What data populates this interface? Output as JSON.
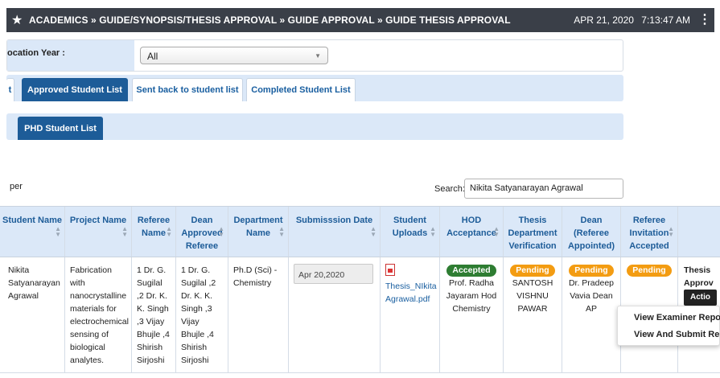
{
  "header": {
    "breadcrumb": "ACADEMICS » GUIDE/SYNOPSIS/THESIS APPROVAL » GUIDE APPROVAL » GUIDE THESIS APPROVAL",
    "date": "APR 21, 2020",
    "time": "7:13:47 AM",
    "icons": [
      "star-icon",
      "kebab-menu-icon"
    ]
  },
  "filter": {
    "label": "ocation Year :",
    "value": "All"
  },
  "tabs": [
    {
      "label": "t",
      "active": false
    },
    {
      "label": "Approved Student List",
      "active": true
    },
    {
      "label": "Sent back to student list",
      "active": false
    },
    {
      "label": "Completed Student List",
      "active": false
    }
  ],
  "subtabs": [
    {
      "label": "PHD Student List",
      "active": true
    }
  ],
  "list": {
    "per_text": "per",
    "search_label": "Search:",
    "search_value": "Nikita Satyanarayan Agrawal"
  },
  "table": {
    "headers": [
      "Student Name",
      "Project Name",
      "Referee Name",
      "Dean Approved Referee",
      "Department Name",
      "Submisssion Date",
      "Student Uploads",
      "HOD Acceptance",
      "Thesis Department Verification",
      "Dean (Referee Appointed)",
      "Referee Invitation Accepted",
      ""
    ],
    "row": {
      "student_name": "Nikita Satyanarayan Agrawal",
      "project_name": "Fabrication with nanocrystalline materials for electrochemical sensing of biological analytes.",
      "referee_name": "1 Dr. G. Sugilal ,2 Dr. K. K. Singh ,3 Vijay Bhujle ,4 Shirish Sirjoshi",
      "dean_approved_referee": "1 Dr. G. Sugilal ,2 Dr. K. K. Singh ,3 Vijay Bhujle ,4 Shirish Sirjoshi",
      "department": "Ph.D (Sci) - Chemistry",
      "submission_date": "Apr 20,2020",
      "upload_file": "Thesis_NIkita Agrawal.pdf",
      "hod_status": "Accepted",
      "hod_name": "Prof. Radha Jayaram Hod Chemistry",
      "verification_status": "Pending",
      "verification_name": "SANTOSH VISHNU PAWAR",
      "dean_status": "Pending",
      "dean_name": "Dr. Pradeep Vavia Dean AP",
      "referee_invitation_status": "Pending",
      "last_col_title": "Thesis Approv",
      "action_label": "Actio"
    },
    "status_colors": {
      "Accepted": "#2e7d32",
      "Pending": "#f39c12"
    }
  },
  "dropdown": {
    "items": [
      "View Examiner Repo",
      "View And Submit Re"
    ]
  }
}
